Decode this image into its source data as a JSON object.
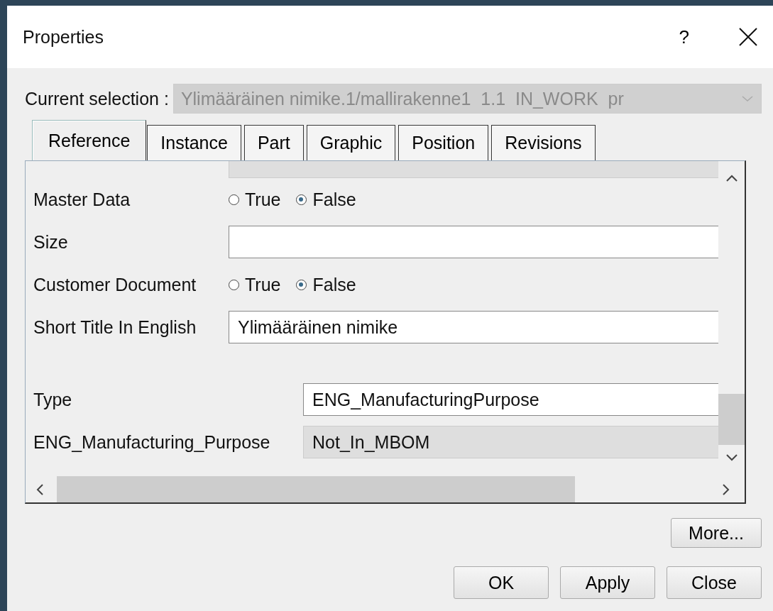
{
  "window": {
    "title": "Properties",
    "help": "?"
  },
  "current_selection": {
    "label": "Current selection :",
    "value": "Ylimääräinen nimike.1/mallirakenne1  1.1  IN_WORK  pr",
    "disabled": true
  },
  "tabs": [
    {
      "label": "Reference",
      "selected": true
    },
    {
      "label": "Instance",
      "selected": false
    },
    {
      "label": "Part",
      "selected": false
    },
    {
      "label": "Graphic",
      "selected": false
    },
    {
      "label": "Position",
      "selected": false
    },
    {
      "label": "Revisions",
      "selected": false
    }
  ],
  "properties": [
    {
      "kind": "readonly"
    },
    {
      "kind": "radio",
      "label": "Master Data",
      "options": [
        {
          "label": "True",
          "selected": false
        },
        {
          "label": "False",
          "selected": true
        }
      ]
    },
    {
      "kind": "text",
      "label": "Size"
    },
    {
      "kind": "radio",
      "label": "Customer Document",
      "options": [
        {
          "label": "True",
          "selected": false
        },
        {
          "label": "False",
          "selected": true
        }
      ]
    },
    {
      "kind": "text",
      "label": "Short Title In English",
      "value": "Ylimääräinen nimike"
    }
  ],
  "type_properties": [
    {
      "kind": "text",
      "label": "Type",
      "value": "ENG_ManufacturingPurpose"
    },
    {
      "kind": "readonly",
      "label": "ENG_Manufacturing_Purpose",
      "value": "Not_In_MBOM"
    }
  ],
  "buttons": [
    {
      "label": "More..."
    }
  ],
  "footer_buttons": [
    {
      "label": "OK"
    },
    {
      "label": "Apply"
    },
    {
      "label": "Close"
    }
  ]
}
